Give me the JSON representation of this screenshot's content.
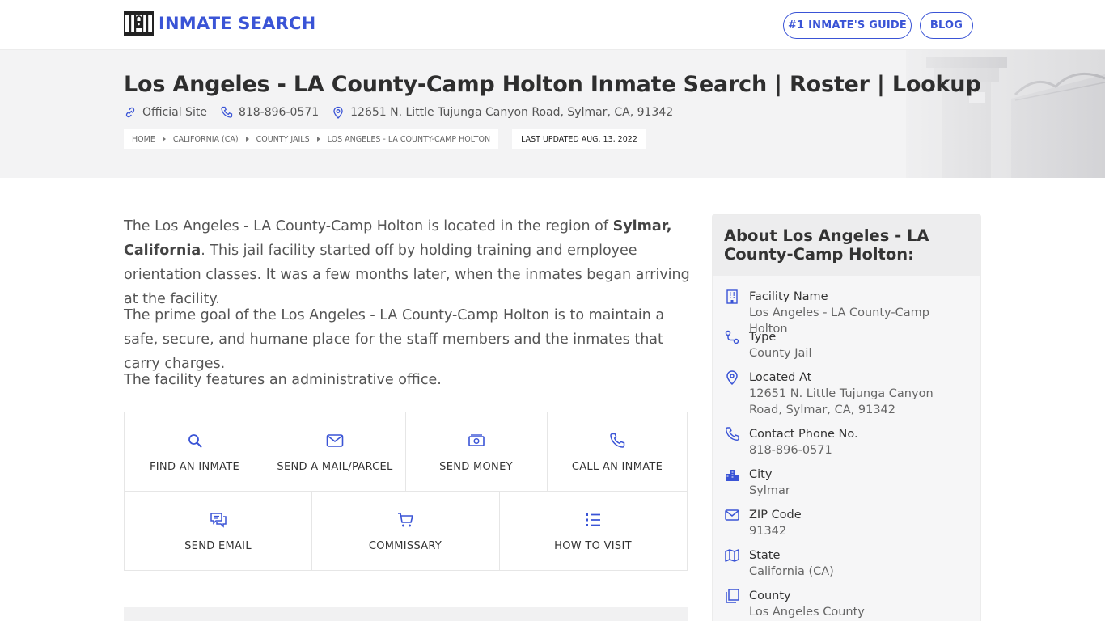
{
  "header": {
    "brand": "INMATE SEARCH",
    "nav": {
      "guide": "#1 INMATE'S GUIDE",
      "blog": "BLOG"
    }
  },
  "hero": {
    "title": "Los Angeles - LA County-Camp Holton Inmate Search | Roster | Lookup",
    "official_site": "Official Site",
    "phone": "818-896-0571",
    "address": "12651 N. Little Tujunga Canyon Road, Sylmar, CA, 91342",
    "breadcrumbs": [
      "HOME",
      "CALIFORNIA (CA)",
      "COUNTY JAILS",
      "LOS ANGELES - LA COUNTY-CAMP HOLTON"
    ],
    "updated": "LAST UPDATED AUG. 13, 2022"
  },
  "content": {
    "p1_a": "The Los Angeles - LA County-Camp Holton is located in the region of ",
    "p1_bold": "Sylmar, California",
    "p1_b": ". This jail facility started off by holding training and employee orientation classes. It was a few months later, when the inmates began arriving at the facility.",
    "p2": "The prime goal of the Los Angeles - LA County-Camp Holton is to maintain a safe, secure, and humane place for the staff members and the inmates that carry charges.",
    "p3": "The facility features an administrative office."
  },
  "services": [
    {
      "label": "FIND AN INMATE",
      "icon": "search-icon"
    },
    {
      "label": "SEND A MAIL/PARCEL",
      "icon": "envelope-icon"
    },
    {
      "label": "SEND MONEY",
      "icon": "money-icon"
    },
    {
      "label": "CALL AN INMATE",
      "icon": "phone-icon"
    },
    {
      "label": "SEND EMAIL",
      "icon": "chat-icon"
    },
    {
      "label": "COMMISSARY",
      "icon": "cart-icon"
    },
    {
      "label": "HOW TO VISIT",
      "icon": "list-icon"
    }
  ],
  "sidebar": {
    "title": "About Los Angeles - LA County-Camp Holton:",
    "items": [
      {
        "label": "Facility Name",
        "value": "Los Angeles - LA County-Camp Holton",
        "icon": "building-icon"
      },
      {
        "label": "Type",
        "value": "County Jail",
        "icon": "route-icon"
      },
      {
        "label": "Located At",
        "value": "12651 N. Little Tujunga Canyon Road, Sylmar, CA, 91342",
        "icon": "map-pin-icon"
      },
      {
        "label": "Contact Phone No.",
        "value": "818-896-0571",
        "icon": "phone-icon"
      },
      {
        "label": "City",
        "value": "Sylmar",
        "icon": "city-icon"
      },
      {
        "label": "ZIP Code",
        "value": "91342",
        "icon": "envelope-icon"
      },
      {
        "label": "State",
        "value": "California (CA)",
        "icon": "map-icon"
      },
      {
        "label": "County",
        "value": "Los Angeles County",
        "icon": "copy-icon"
      }
    ]
  },
  "colors": {
    "accent": "#3a54d6",
    "hero_bg": "#f3f3f4",
    "sidebar_bg": "#f6f6f7"
  }
}
